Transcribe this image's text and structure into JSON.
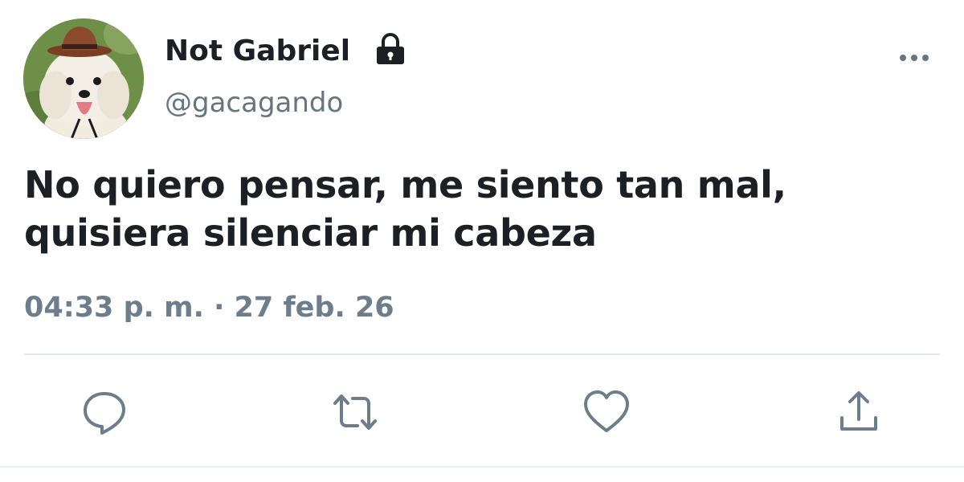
{
  "user": {
    "display_name": "Not Gabriel",
    "handle": "@gacagando",
    "protected_icon": "lock-icon",
    "avatar": "dog-with-hat-avatar"
  },
  "tweet": {
    "text_lines": [
      "No quiero pensar, me siento tan mal,",
      "quisiera silenciar mi cabeza"
    ],
    "timestamp": "04:33 p. m. · 27 feb. 26"
  },
  "actions": [
    {
      "name": "reply",
      "icon": "reply-icon"
    },
    {
      "name": "retweet",
      "icon": "retweet-icon"
    },
    {
      "name": "like",
      "icon": "heart-icon"
    },
    {
      "name": "share",
      "icon": "share-icon"
    }
  ],
  "menu": {
    "icon": "more-icon"
  },
  "colors": {
    "text": "#1c1f23",
    "secondary": "#66757f",
    "icon": "#6e7d8c",
    "divider": "#e3e7ea"
  }
}
